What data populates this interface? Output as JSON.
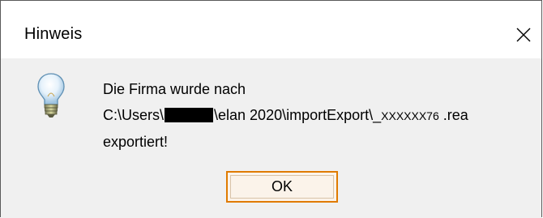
{
  "window": {
    "title": "Hinweis",
    "close_icon": "close-icon"
  },
  "message": {
    "icon": "lightbulb-icon",
    "line1": "Die Firma wurde nach",
    "path_prefix": "C:\\Users\\",
    "path_middle": "\\elan 2020\\importExport\\_",
    "path_code": "XXXXXX76",
    "path_ext": " .rea",
    "line3": "exportiert!"
  },
  "buttons": {
    "ok_label": "OK"
  }
}
